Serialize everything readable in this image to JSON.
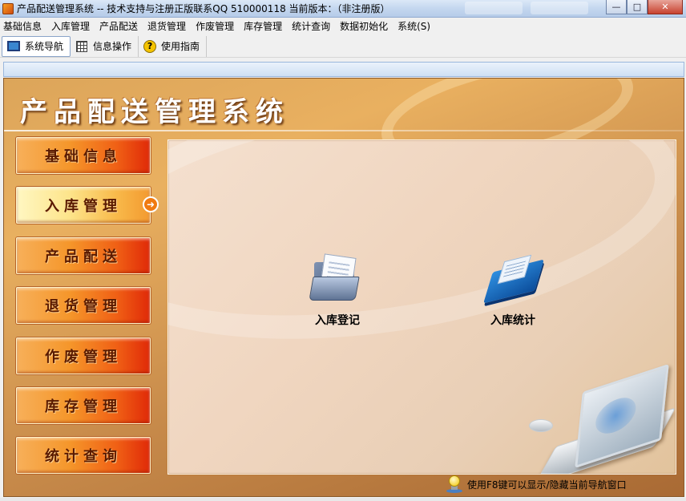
{
  "window": {
    "title": "产品配送管理系统 -- 技术支持与注册正版联系QQ 510000118    当前版本：（非注册版）",
    "buttons": {
      "minimize": "—",
      "maximize": "□",
      "close": "✕"
    }
  },
  "menu": {
    "items": [
      "基础信息",
      "入库管理",
      "产品配送",
      "退货管理",
      "作废管理",
      "库存管理",
      "统计查询",
      "数据初始化",
      "系统(S)"
    ]
  },
  "toolbar": {
    "items": [
      {
        "label": "系统导航",
        "icon": "monitor-icon"
      },
      {
        "label": "信息操作",
        "icon": "grid-icon"
      },
      {
        "label": "使用指南",
        "icon": "help-icon"
      }
    ]
  },
  "main": {
    "title": "产品配送管理系统",
    "nav": [
      {
        "label": "基础信息",
        "active": false
      },
      {
        "label": "入库管理",
        "active": true
      },
      {
        "label": "产品配送",
        "active": false
      },
      {
        "label": "退货管理",
        "active": false
      },
      {
        "label": "作废管理",
        "active": false
      },
      {
        "label": "库存管理",
        "active": false
      },
      {
        "label": "统计查询",
        "active": false
      }
    ],
    "launchers": [
      {
        "label": "入库登记",
        "icon": "folder-document-icon"
      },
      {
        "label": "入库统计",
        "icon": "book-icon"
      }
    ],
    "hint": "使用F8键可以显示/隐藏当前导航窗口"
  },
  "colors": {
    "nav_button": "#f06015",
    "nav_button_active": "#fde48a",
    "panel_background": "#dca55a",
    "content_background": "#f0d6c0",
    "title_bar": "#c4d7ef"
  }
}
